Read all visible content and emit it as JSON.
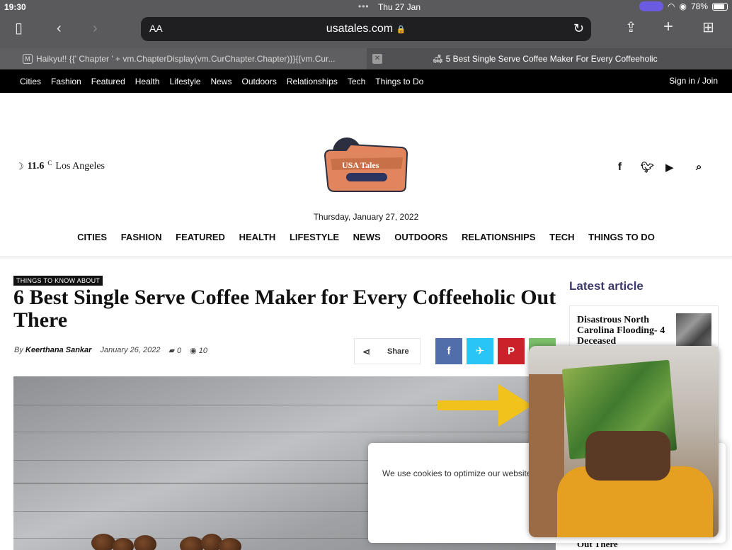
{
  "status": {
    "time": "19:30",
    "date": "Thu 27 Jan",
    "battery": "78%",
    "dots": "•••"
  },
  "browser": {
    "aa_label": "AA",
    "url": "usatales.com",
    "lock": "🔒",
    "tabs": [
      {
        "favicon": "M",
        "title": "Haikyu!! {{' Chapter ' + vm.ChapterDisplay(vm.CurChapter.Chapter)}}{{vm.Cur..."
      },
      {
        "close": "✕",
        "title": "🛋 5 Best Single Serve Coffee Maker For Every Coffeeholic"
      }
    ]
  },
  "topnav": {
    "links": [
      "Cities",
      "Fashion",
      "Featured",
      "Health",
      "Lifestyle",
      "News",
      "Outdoors",
      "Relationships",
      "Tech",
      "Things to Do"
    ],
    "signin": "Sign in / Join"
  },
  "header": {
    "weather": {
      "moon": "☽",
      "temp": "11.6",
      "unit": "C",
      "city": "Los Angeles"
    },
    "logo_text": "USA Tales",
    "date": "Thursday, January 27, 2022",
    "nav": [
      "CITIES",
      "FASHION",
      "FEATURED",
      "HEALTH",
      "LIFESTYLE",
      "NEWS",
      "OUTDOORS",
      "RELATIONSHIPS",
      "TECH",
      "THINGS TO DO"
    ],
    "social_icons": [
      "facebook-icon",
      "twitter-icon",
      "youtube-icon",
      "search-icon"
    ]
  },
  "article": {
    "category": "THINGS TO KNOW ABOUT",
    "title": "6 Best Single Serve Coffee Maker for Every Coffeeholic Out There",
    "by": "By",
    "author": "Keerthana Sankar",
    "date": "January 26, 2022",
    "comments": "0",
    "views": "10",
    "share_label": "Share",
    "share_colors": {
      "facebook": "#516eab",
      "twitter": "#29c5f6",
      "pinterest": "#ca212a",
      "whatsapp": "#7bbf6a"
    }
  },
  "sidebar": {
    "heading": "Latest article",
    "item_title": "Disastrous North Carolina Flooding- 4 Deceased",
    "bottom_cut": "Out There"
  },
  "cookie": {
    "text": "We use cookies to optimize our website"
  }
}
